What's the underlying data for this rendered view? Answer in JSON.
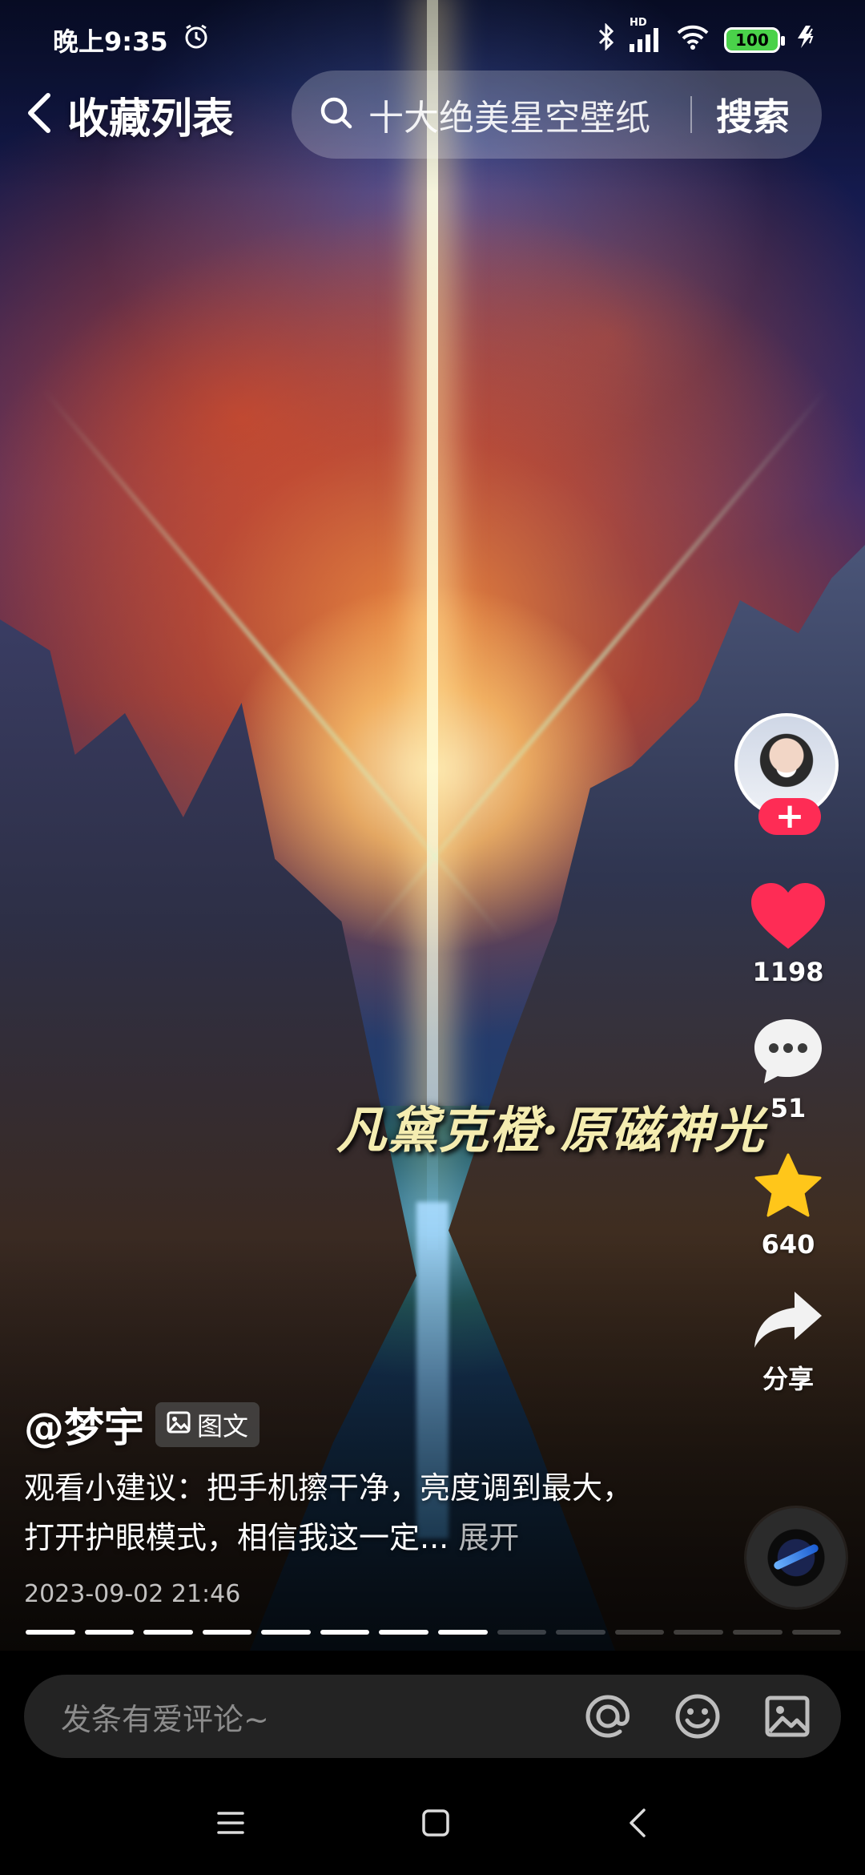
{
  "status_bar": {
    "time": "晚上9:35",
    "network_label": "HD",
    "battery": "100"
  },
  "nav": {
    "back_icon": "chevron-left-icon",
    "title": "收藏列表",
    "search_query": "十大绝美星空壁纸",
    "search_button": "搜索"
  },
  "post": {
    "overlay_caption": "凡黛克橙·原磁神光",
    "author": "@梦宇",
    "type_badge": "图文",
    "description": "观看小建议：把手机擦干净，亮度调到最大，打开护眼模式，相信我这一定...",
    "expand_label": "展开",
    "date": "2023-09-02 21:46",
    "image_progress": {
      "current": 8,
      "total": 14
    }
  },
  "actions": {
    "follow_label": "+",
    "likes": "1198",
    "comments": "51",
    "favorites": "640",
    "share_label": "分享"
  },
  "comment_bar": {
    "placeholder": "发条有爱评论~"
  },
  "colors": {
    "like_red": "#fe2c55",
    "favorite_gold": "#ffc61a",
    "battery_green": "#4ad24a"
  }
}
